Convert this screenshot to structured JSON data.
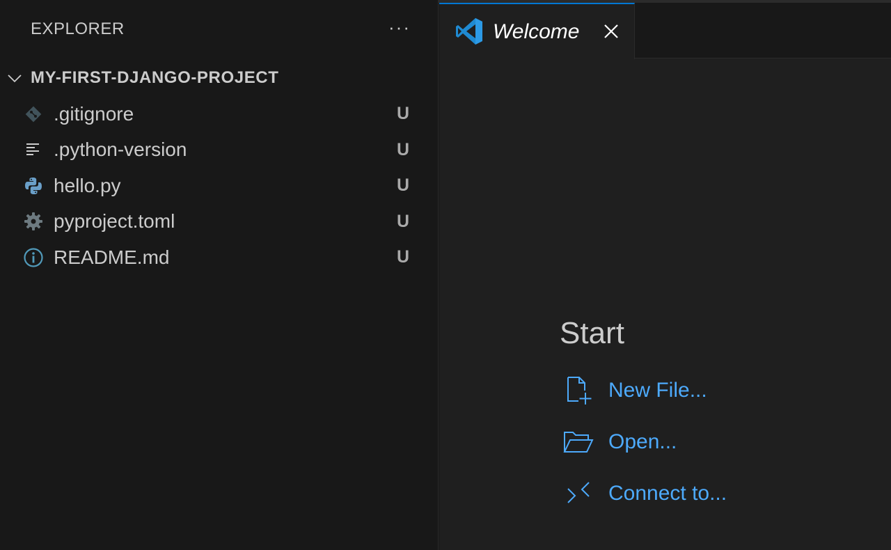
{
  "sidebar": {
    "title": "EXPLORER",
    "more_label": "···",
    "project_name": "MY-FIRST-DJANGO-PROJECT",
    "files": [
      {
        "name": ".gitignore",
        "status": "U",
        "icon": "git-icon"
      },
      {
        "name": ".python-version",
        "status": "U",
        "icon": "text-lines-icon"
      },
      {
        "name": "hello.py",
        "status": "U",
        "icon": "python-icon"
      },
      {
        "name": "pyproject.toml",
        "status": "U",
        "icon": "gear-icon"
      },
      {
        "name": "README.md",
        "status": "U",
        "icon": "info-icon"
      }
    ]
  },
  "editor": {
    "tab": {
      "label": "Welcome",
      "icon": "vscode-logo-icon"
    },
    "welcome": {
      "start_title": "Start",
      "links": [
        {
          "label": "New File...",
          "icon": "new-file-icon"
        },
        {
          "label": "Open...",
          "icon": "folder-open-icon"
        },
        {
          "label": "Connect to...",
          "icon": "remote-icon"
        }
      ]
    }
  },
  "colors": {
    "background": "#181818",
    "editor_background": "#1f1f1f",
    "accent": "#0078d4",
    "link": "#4daafc",
    "text": "#cccccc"
  }
}
